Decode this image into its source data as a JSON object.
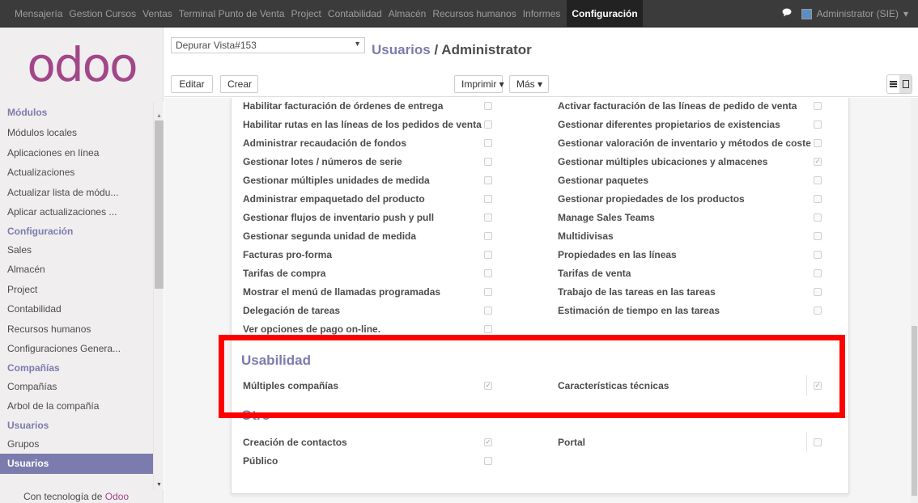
{
  "topbar": {
    "menu": [
      "Mensajería",
      "Gestion Cursos",
      "Ventas",
      "Terminal Punto de Venta",
      "Project",
      "Contabilidad",
      "Almacén",
      "Recursos humanos",
      "Informes"
    ],
    "active": "Configuración",
    "user": "Administrator (SIE)",
    "user_caret": "▾",
    "chat_icon": "chat-icon"
  },
  "sidebar": {
    "logo": "odoo",
    "sections": [
      {
        "title": "Módulos",
        "items": [
          "Módulos locales",
          "Aplicaciones en línea",
          "Actualizaciones",
          "Actualizar lista de módu...",
          "Aplicar actualizaciones ..."
        ]
      },
      {
        "title": "Configuración",
        "items": [
          "Sales",
          "Almacén",
          "Project",
          "Contabilidad",
          "Recursos humanos",
          "Configuraciones Genera..."
        ]
      },
      {
        "title": "Compañías",
        "items": [
          "Compañías",
          "Arbol de la compañía"
        ]
      },
      {
        "title": "Usuarios",
        "items": [
          "Grupos",
          "Usuarios"
        ]
      }
    ],
    "active_item": "Usuarios",
    "powered_prefix": "Con tecnología de ",
    "powered_brand": "Odoo"
  },
  "control_panel": {
    "debug_view": "Depurar Vista#153",
    "breadcrumb_link": "Usuarios",
    "breadcrumb_sep": " / ",
    "breadcrumb_current": "Administrator",
    "edit_label": "Editar",
    "create_label": "Crear",
    "print_label": "Imprimir ▾",
    "more_label": "Más ▾",
    "view_list_icon": "list-view-icon",
    "view_form_icon": "form-view-icon"
  },
  "features": {
    "left": [
      {
        "label": "Habilitar facturación de órdenes de entrega",
        "checked": false
      },
      {
        "label": "Habilitar rutas en las líneas de los pedidos de venta",
        "checked": false
      },
      {
        "label": "Administrar recaudación de fondos",
        "checked": false
      },
      {
        "label": "Gestionar lotes / números de serie",
        "checked": false
      },
      {
        "label": "Gestionar múltiples unidades de medida",
        "checked": false
      },
      {
        "label": "Administrar empaquetado del producto",
        "checked": false
      },
      {
        "label": "Gestionar flujos de inventario push y pull",
        "checked": false
      },
      {
        "label": "Gestionar segunda unidad de medida",
        "checked": false
      },
      {
        "label": "Facturas pro-forma",
        "checked": false
      },
      {
        "label": "Tarifas de compra",
        "checked": false
      },
      {
        "label": "Mostrar el menú de llamadas programadas",
        "checked": false
      },
      {
        "label": "Delegación de tareas",
        "checked": false
      },
      {
        "label": "Ver opciones de pago on-line.",
        "checked": false
      }
    ],
    "right": [
      {
        "label": "Activar facturación de las líneas de pedido de venta",
        "checked": false
      },
      {
        "label": "Gestionar diferentes propietarios de existencias",
        "checked": false
      },
      {
        "label": "Gestionar valoración de inventario y métodos de coste",
        "checked": false
      },
      {
        "label": "Gestionar múltiples ubicaciones y almacenes",
        "checked": true
      },
      {
        "label": "Gestionar paquetes",
        "checked": false
      },
      {
        "label": "Gestionar propiedades de los productos",
        "checked": false
      },
      {
        "label": "Manage Sales Teams",
        "checked": false
      },
      {
        "label": "Multidivisas",
        "checked": false
      },
      {
        "label": "Propiedades en las líneas",
        "checked": false
      },
      {
        "label": "Tarifas de venta",
        "checked": false
      },
      {
        "label": "Trabajo de las tareas en las tareas",
        "checked": false
      },
      {
        "label": "Estimación de tiempo en las tareas",
        "checked": false
      }
    ]
  },
  "usabilidad": {
    "title": "Usabilidad",
    "left": {
      "label": "Múltiples compañías",
      "checked": true
    },
    "right": {
      "label": "Características técnicas",
      "checked": true
    }
  },
  "otro": {
    "title": "Otro",
    "left": [
      {
        "label": "Creación de contactos",
        "checked": true
      },
      {
        "label": "Público",
        "checked": false
      }
    ],
    "right": [
      {
        "label": "Portal",
        "checked": false
      }
    ]
  },
  "colors": {
    "accent": "#7c7bad",
    "brand": "#a24689",
    "highlight": "#ff0000"
  }
}
